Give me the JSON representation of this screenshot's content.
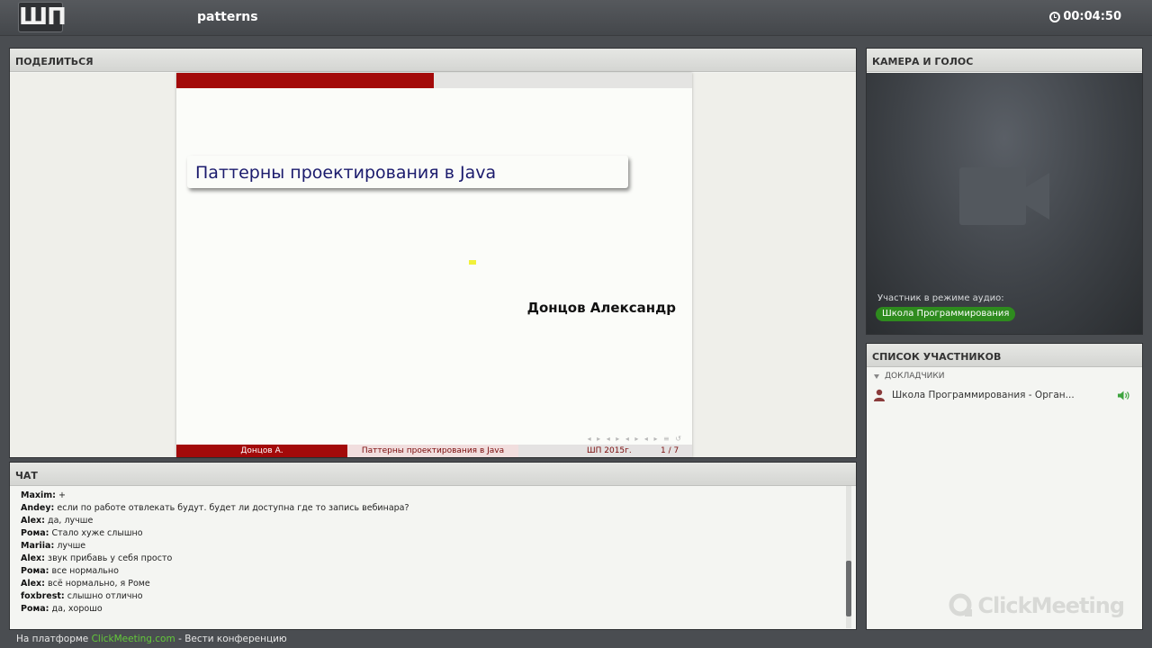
{
  "topbar": {
    "logo_text": "ШП",
    "room_title": "patterns",
    "timer": "00:04:50"
  },
  "share_panel": {
    "header": "ПОДЕЛИТЬСЯ",
    "slide": {
      "title": "Паттерны проектирования в Java",
      "author": "Донцов Александр",
      "nav_symbols": "◂ ▸ ◂ ▸ ◂ ▸ ◂ ▸ ≡ ↺",
      "footer_author": "Донцов А.",
      "footer_title": "Паттерны проектирования в Java",
      "footer_year": "ШП 2015г.",
      "footer_page": "1 / 7"
    }
  },
  "camera_panel": {
    "header": "КАМЕРА И ГОЛОС",
    "audio_label": "Участник в режиме аудио:",
    "audio_participant": "Школа Программирования"
  },
  "participants_panel": {
    "header": "СПИСОК УЧАСТНИКОВ",
    "group_label": "ДОКЛАДЧИКИ",
    "participants": [
      {
        "name": "Школа Программирования - Орган..."
      }
    ],
    "watermark": "ClickMeeting"
  },
  "chat_panel": {
    "header": "ЧАТ",
    "messages": [
      {
        "author": "Maxim:",
        "text": "+"
      },
      {
        "author": "Andey:",
        "text": "если по работе отвлекать будут. будет ли доступна где то запись вебинара?"
      },
      {
        "author": "Alex:",
        "text": "да, лучше"
      },
      {
        "author": "Рома:",
        "text": "Стало хуже слышно"
      },
      {
        "author": "Mariia:",
        "text": "лучше"
      },
      {
        "author": "Alex:",
        "text": "звук прибавь у себя просто"
      },
      {
        "author": "Рома:",
        "text": "все нормально"
      },
      {
        "author": "Alex:",
        "text": "всё нормально, я Роме"
      },
      {
        "author": "foxbrest:",
        "text": "слышно отлично"
      },
      {
        "author": "Рома:",
        "text": "да, хорошо"
      }
    ]
  },
  "footer": {
    "prefix": "На платформе",
    "link": "ClickMeeting.com",
    "suffix": "- Вести конференцию"
  }
}
